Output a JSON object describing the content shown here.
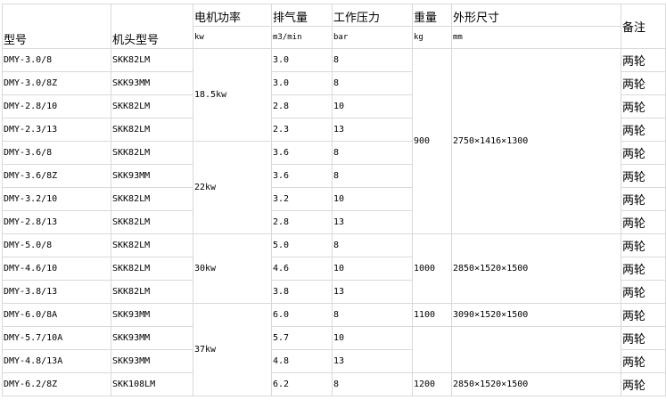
{
  "headers": {
    "model": "型号",
    "head_model": "机头型号",
    "power": "电机功率",
    "power_unit": "kw",
    "air": "排气量",
    "air_unit": "m3/min",
    "pressure": "工作压力",
    "pressure_unit": "bar",
    "weight": "重量",
    "weight_unit": "kg",
    "dims": "外形尺寸",
    "dims_unit": "mm",
    "remark": "备注"
  },
  "rows": [
    {
      "model": "DMY-3.0/8",
      "head": "SKK82LM",
      "air": "3.0",
      "pressure": "8",
      "remark": "两轮"
    },
    {
      "model": "DMY-3.0/8Z",
      "head": "SKK93MM",
      "air": "3.0",
      "pressure": "8",
      "remark": "两轮"
    },
    {
      "model": "DMY-2.8/10",
      "head": "SKK82LM",
      "air": "2.8",
      "pressure": "10",
      "remark": "两轮"
    },
    {
      "model": "DMY-2.3/13",
      "head": "SKK82LM",
      "air": "2.3",
      "pressure": "13",
      "remark": "两轮"
    },
    {
      "model": "DMY-3.6/8",
      "head": "SKK82LM",
      "air": "3.6",
      "pressure": "8",
      "remark": "两轮"
    },
    {
      "model": "DMY-3.6/8Z",
      "head": "SKK93MM",
      "air": "3.6",
      "pressure": "8",
      "remark": "两轮"
    },
    {
      "model": "DMY-3.2/10",
      "head": "SKK82LM",
      "air": "3.2",
      "pressure": "10",
      "remark": "两轮"
    },
    {
      "model": "DMY-2.8/13",
      "head": "SKK82LM",
      "air": "2.8",
      "pressure": "13",
      "remark": "两轮"
    },
    {
      "model": "DMY-5.0/8",
      "head": "SKK82LM",
      "air": "5.0",
      "pressure": "8",
      "remark": "两轮"
    },
    {
      "model": "DMY-4.6/10",
      "head": "SKK82LM",
      "air": "4.6",
      "pressure": "10",
      "remark": "两轮"
    },
    {
      "model": "DMY-3.8/13",
      "head": "SKK82LM",
      "air": "3.8",
      "pressure": "13",
      "remark": "两轮"
    },
    {
      "model": "DMY-6.0/8A",
      "head": "SKK93MM",
      "air": "6.0",
      "pressure": "8",
      "remark": "两轮"
    },
    {
      "model": "DMY-5.7/10A",
      "head": "SKK93MM",
      "air": "5.7",
      "pressure": "10",
      "remark": "两轮"
    },
    {
      "model": "DMY-4.8/13A",
      "head": "SKK93MM",
      "air": "4.8",
      "pressure": "13",
      "remark": "两轮"
    },
    {
      "model": "DMY-6.2/8Z",
      "head": "SKK108LM",
      "air": "6.2",
      "pressure": "8",
      "remark": "两轮"
    }
  ],
  "power_groups": [
    "18.5kw",
    "22kw",
    "30kw",
    "37kw"
  ],
  "weight_groups": [
    "900",
    "1000",
    "1100",
    "",
    "1200"
  ],
  "dims_groups": [
    "2750×1416×1300",
    "2850×1520×1500",
    "3090×1520×1500",
    "",
    "2850×1520×1500"
  ]
}
